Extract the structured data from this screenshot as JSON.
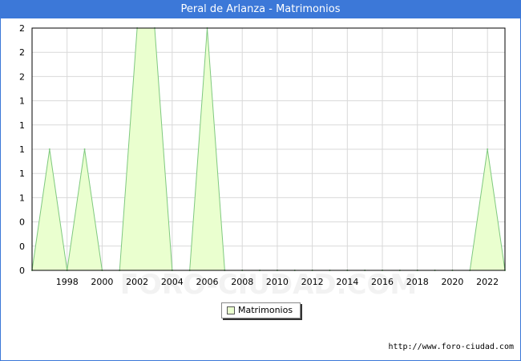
{
  "window": {
    "title": "Peral de Arlanza - Matrimonios"
  },
  "source": "http://www.foro-ciudad.com",
  "watermark": "FORO-CIUDAD.COM",
  "colors": {
    "title_bar": "#3c78d8",
    "fill": "#eaffcf",
    "line": "#7fc97f",
    "grid": "#d9d9d9"
  },
  "chart_data": {
    "type": "area",
    "title": "Peral de Arlanza - Matrimonios",
    "x": [
      1996,
      1997,
      1998,
      1999,
      2000,
      2001,
      2002,
      2003,
      2004,
      2005,
      2006,
      2007,
      2008,
      2009,
      2010,
      2011,
      2012,
      2013,
      2014,
      2015,
      2016,
      2017,
      2018,
      2019,
      2020,
      2021,
      2022,
      2023
    ],
    "series": [
      {
        "name": "Matrimonios",
        "values": [
          0,
          1,
          0,
          1,
          0,
          0,
          2,
          2,
          0,
          0,
          2,
          0,
          0,
          0,
          0,
          0,
          0,
          0,
          0,
          0,
          0,
          0,
          0,
          0,
          0,
          0,
          1,
          0
        ]
      }
    ],
    "xticks": [
      "1998",
      "2000",
      "2002",
      "2004",
      "2006",
      "2008",
      "2010",
      "2012",
      "2014",
      "2016",
      "2018",
      "2020",
      "2022"
    ],
    "yticks": [
      "0",
      "0",
      "0",
      "1",
      "1",
      "1",
      "1",
      "1",
      "2",
      "2",
      "2"
    ],
    "ylim": [
      0,
      2
    ],
    "grid": true,
    "legend": "bottom-center"
  }
}
